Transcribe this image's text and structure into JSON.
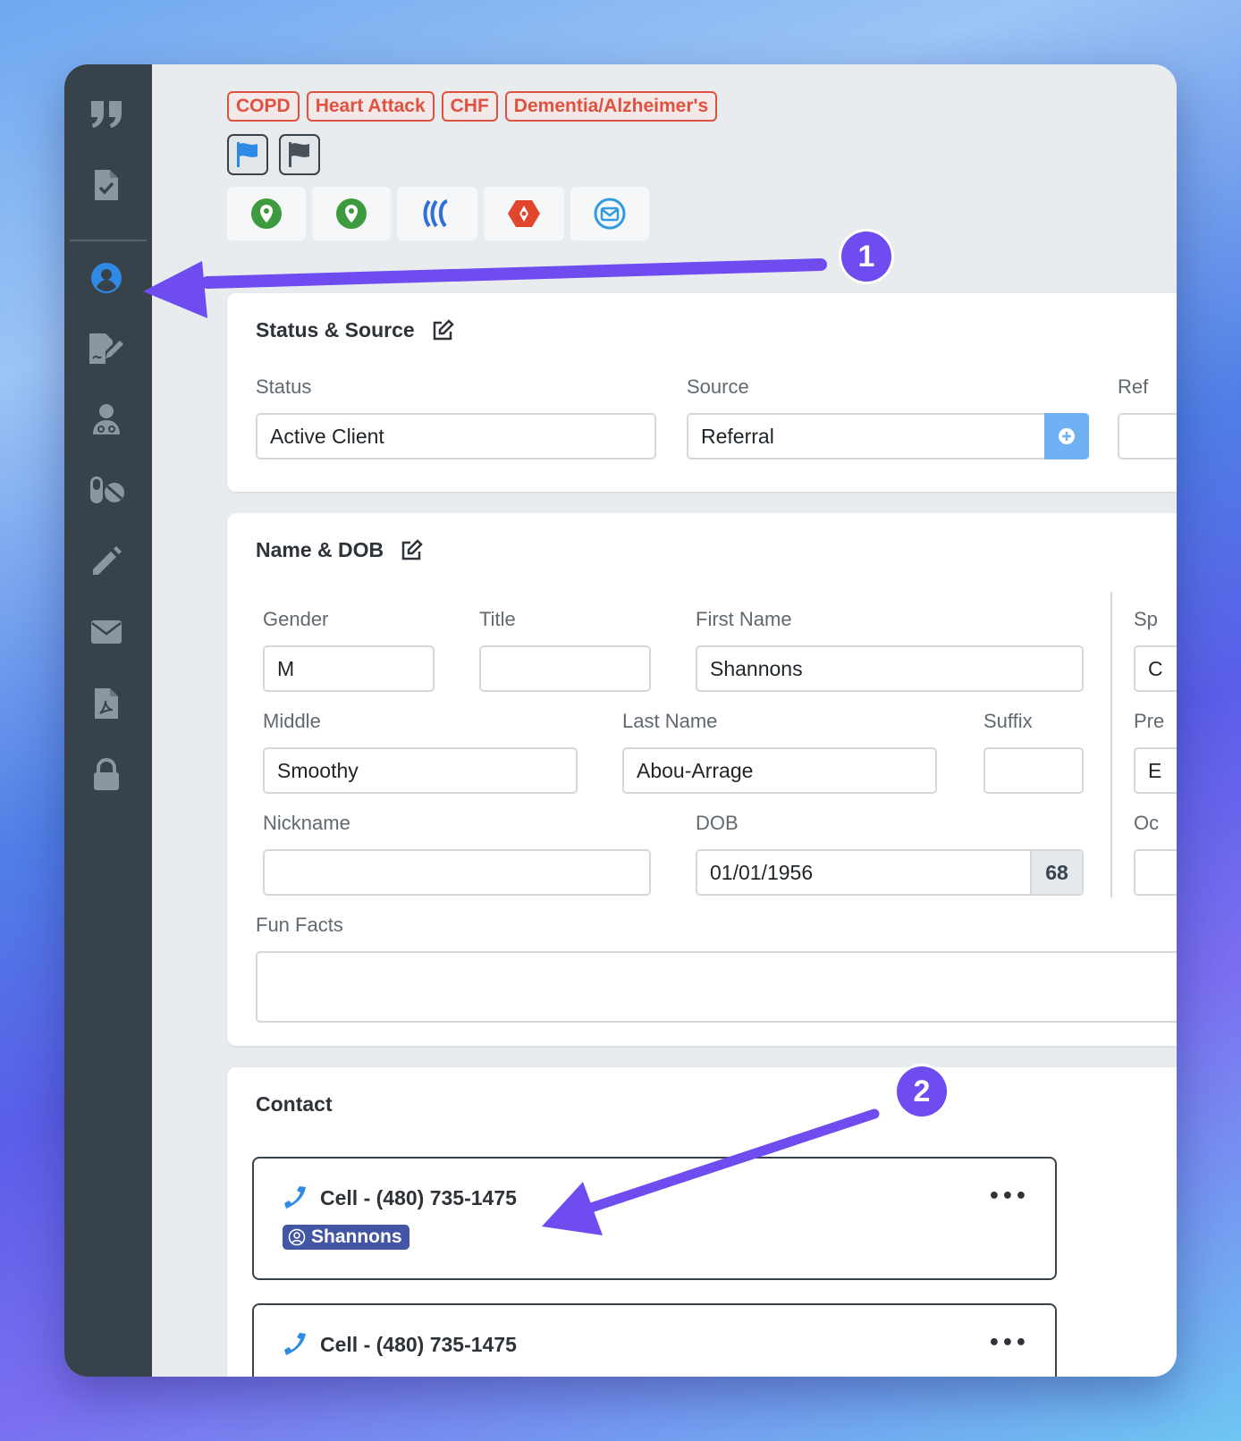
{
  "tags": [
    "COPD",
    "Heart Attack",
    "CHF",
    "Dementia/Alzheimer's"
  ],
  "colors": {
    "sidebar": "#37424b",
    "tag_red": "#e0513f",
    "active_icon": "#2f8ae6",
    "annotation": "#6e4cf0",
    "badge": "#4356a6"
  },
  "sidebar": {
    "items": [
      "quote-icon",
      "checklist-file-icon",
      "user-circle-icon",
      "signature-icon",
      "caregiver-icon",
      "pills-icon",
      "pencil-icon",
      "envelope-icon",
      "pdf-file-icon",
      "lock-icon"
    ]
  },
  "status_source": {
    "title": "Status & Source",
    "status_label": "Status",
    "status_value": "Active Client",
    "source_label": "Source",
    "source_value": "Referral",
    "ref_label": "Ref"
  },
  "name_dob": {
    "title": "Name & DOB",
    "gender_label": "Gender",
    "gender_value": "M",
    "title_label": "Title",
    "title_value": "",
    "first_label": "First Name",
    "first_value": "Shannons",
    "middle_label": "Middle",
    "middle_value": "Smoothy",
    "last_label": "Last Name",
    "last_value": "Abou-Arrage",
    "suffix_label": "Suffix",
    "suffix_value": "",
    "nickname_label": "Nickname",
    "nickname_value": "",
    "dob_label": "DOB",
    "dob_value": "01/01/1956",
    "age": "68",
    "fun_label": "Fun Facts",
    "sp_label": "Sp",
    "sp_value": "C",
    "pre_label": "Pre",
    "pre_value": "E",
    "oc_label": "Oc"
  },
  "contact": {
    "title": "Contact",
    "entries": [
      {
        "label": "Cell - (480) 735-1475",
        "person": "Shannons"
      },
      {
        "label": "Cell - (480) 735-1475"
      }
    ]
  },
  "annotations": {
    "one": "1",
    "two": "2"
  }
}
